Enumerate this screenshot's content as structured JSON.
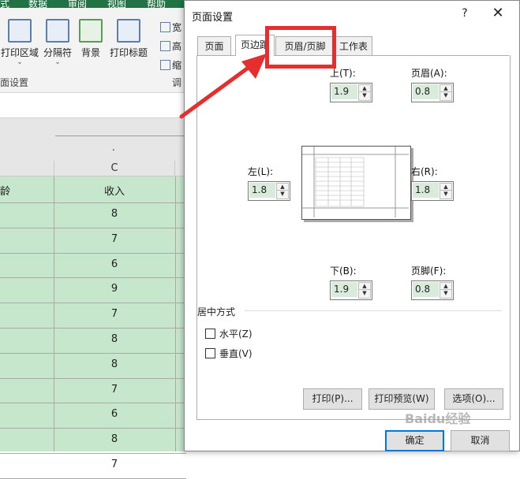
{
  "ribbon": {
    "tabs": [
      "式",
      "数据",
      "审阅",
      "视图",
      "帮助"
    ],
    "buttons": [
      "打印区域",
      "分隔符",
      "背景",
      "打印标题"
    ],
    "side_items": [
      "宽",
      "高",
      "缩"
    ],
    "group_label": "面设置",
    "group_label2": "调"
  },
  "sheet": {
    "dot": ".",
    "column_header": "C",
    "left_header_fragment": "龄",
    "header": "收入",
    "values": [
      "8",
      "7",
      "6",
      "9",
      "7",
      "8",
      "8",
      "7",
      "6",
      "8",
      "7"
    ]
  },
  "dialog": {
    "title": "页面设置",
    "help": "?",
    "close": "✕",
    "tabs": [
      "页面",
      "页边距",
      "页眉/页脚",
      "工作表"
    ],
    "active_tab": "页边距",
    "top_label": "上(T):",
    "top_value": "1.9",
    "header_label": "页眉(A):",
    "header_value": "0.8",
    "left_label": "左(L):",
    "left_value": "1.8",
    "right_label": "右(R):",
    "right_value": "1.8",
    "bottom_label": "下(B):",
    "bottom_value": "1.9",
    "footer_label": "页脚(F):",
    "footer_value": "0.8",
    "center_heading": "居中方式",
    "horizontal": "水平(Z)",
    "vertical": "垂直(V)",
    "horizontal_checked": false,
    "vertical_checked": false,
    "print_button": "打印(P)...",
    "preview_button": "打印预览(W)",
    "options_button": "选项(O)...",
    "ok_button": "确定",
    "cancel_button": "取消",
    "spinner_up": "▲",
    "spinner_down": "▼"
  },
  "annotation": {
    "color": "#e62e2e",
    "highlighted_tab": "页眉/页脚"
  },
  "watermark": "Baidu经验"
}
